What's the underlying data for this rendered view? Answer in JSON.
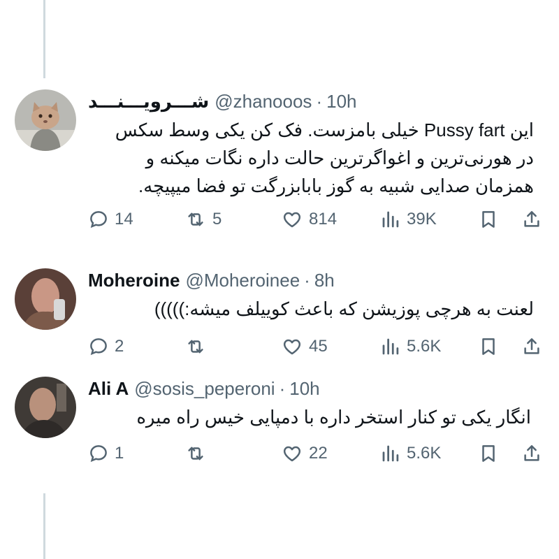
{
  "tweets": [
    {
      "name": "شـــرویـــنـــد",
      "handle": "@zhanooos",
      "dot": "·",
      "time": "10h",
      "lines": [
        "این Pussy fart خیلی بامزست. فک کن یکی وسط سکس",
        "در هورنی‌ترین و اغواگرترین حالت داره نگات میکنه و",
        "همزمان صدایی شبیه به گوز بابابزرگت تو فضا میپیچه."
      ],
      "replies": "14",
      "reposts": "5",
      "likes": "814",
      "views": "39K"
    },
    {
      "name": "Moheroine",
      "handle": "@Moheroinee",
      "dot": "·",
      "time": "8h",
      "lines": [
        "لعنت به هرچی پوزیشن که باعث کوییلف میشه:)))))"
      ],
      "replies": "2",
      "reposts": "",
      "likes": "45",
      "views": "5.6K"
    },
    {
      "name": "Ali A",
      "handle": "@sosis_peperoni",
      "dot": "·",
      "time": "10h",
      "lines": [
        "انگار یکی تو کنار استخر داره با دمپایی خیس راه میره"
      ],
      "replies": "1",
      "reposts": "",
      "likes": "22",
      "views": "5.6K"
    }
  ],
  "icons": [
    "reply-icon",
    "repost-icon",
    "like-icon",
    "views-icon",
    "bookmark-icon",
    "share-icon"
  ],
  "colors": {
    "text": "#0f1419",
    "muted": "#536471",
    "thread_line": "#cfd9de"
  }
}
